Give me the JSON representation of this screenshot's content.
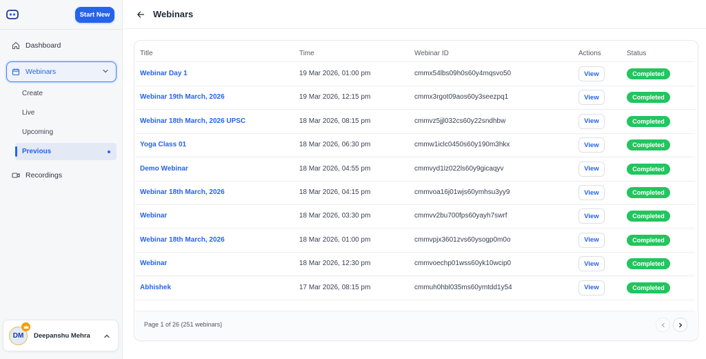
{
  "sidebar": {
    "start_button": "Start New",
    "nav": {
      "dashboard": "Dashboard",
      "webinars": "Webinars",
      "recordings": "Recordings"
    },
    "sub_items": [
      "Create",
      "Live",
      "Upcoming",
      "Previous"
    ],
    "active_sub": "Previous",
    "user": {
      "initials": "DM",
      "name": "Deepanshu Mehra"
    }
  },
  "header": {
    "title": "Webinars"
  },
  "table": {
    "columns": [
      "Title",
      "Time",
      "Webinar ID",
      "Actions",
      "Status"
    ],
    "action_label": "View",
    "rows": [
      {
        "title": "Webinar Day 1",
        "time": "19 Mar 2026, 01:00 pm",
        "id": "cmmx54lbs09h0s60y4mqsvo50",
        "status": "Completed"
      },
      {
        "title": "Webinar 19th March, 2026",
        "time": "19 Mar 2026, 12:15 pm",
        "id": "cmmx3rgot09aos60y3seezpq1",
        "status": "Completed"
      },
      {
        "title": "Webinar 18th March, 2026 UPSC",
        "time": "18 Mar 2026, 08:15 pm",
        "id": "cmmvz5jjl032cs60y22sndhbw",
        "status": "Completed"
      },
      {
        "title": "Yoga Class 01",
        "time": "18 Mar 2026, 06:30 pm",
        "id": "cmmw1iclc0450s60y190m3hkx",
        "status": "Completed"
      },
      {
        "title": "Demo Webinar",
        "time": "18 Mar 2026, 04:55 pm",
        "id": "cmmvyd1lz022ls60y9gicaqyv",
        "status": "Completed"
      },
      {
        "title": "Webinar 18th March, 2026",
        "time": "18 Mar 2026, 04:15 pm",
        "id": "cmmvoa16j01wjs60ymhsu3yy9",
        "status": "Completed"
      },
      {
        "title": "Webinar",
        "time": "18 Mar 2026, 03:30 pm",
        "id": "cmmvv2bu700fps60yayh7swrf",
        "status": "Completed"
      },
      {
        "title": "Webinar 18th March, 2026",
        "time": "18 Mar 2026, 01:00 pm",
        "id": "cmmvpjx3601zvs60ysogp0m0o",
        "status": "Completed"
      },
      {
        "title": "Webinar",
        "time": "18 Mar 2026, 12:30 pm",
        "id": "cmmvoechp01wss60yk10wcip0",
        "status": "Completed"
      },
      {
        "title": "Abhishek",
        "time": "17 Mar 2026, 08:15 pm",
        "id": "cmmuh0hbl035ms60ymtdd1y54",
        "status": "Completed"
      }
    ]
  },
  "pagination": {
    "info": "Page 1 of 26 (251 webinars)"
  },
  "colors": {
    "accent": "#2563eb",
    "success": "#22c55e"
  },
  "icons": [
    "app-logo-icon",
    "home-icon",
    "calendar-icon",
    "chevron-down-icon",
    "video-icon",
    "back-arrow-icon",
    "crown-icon",
    "chevron-up-icon",
    "chevron-left-icon",
    "chevron-right-icon"
  ]
}
